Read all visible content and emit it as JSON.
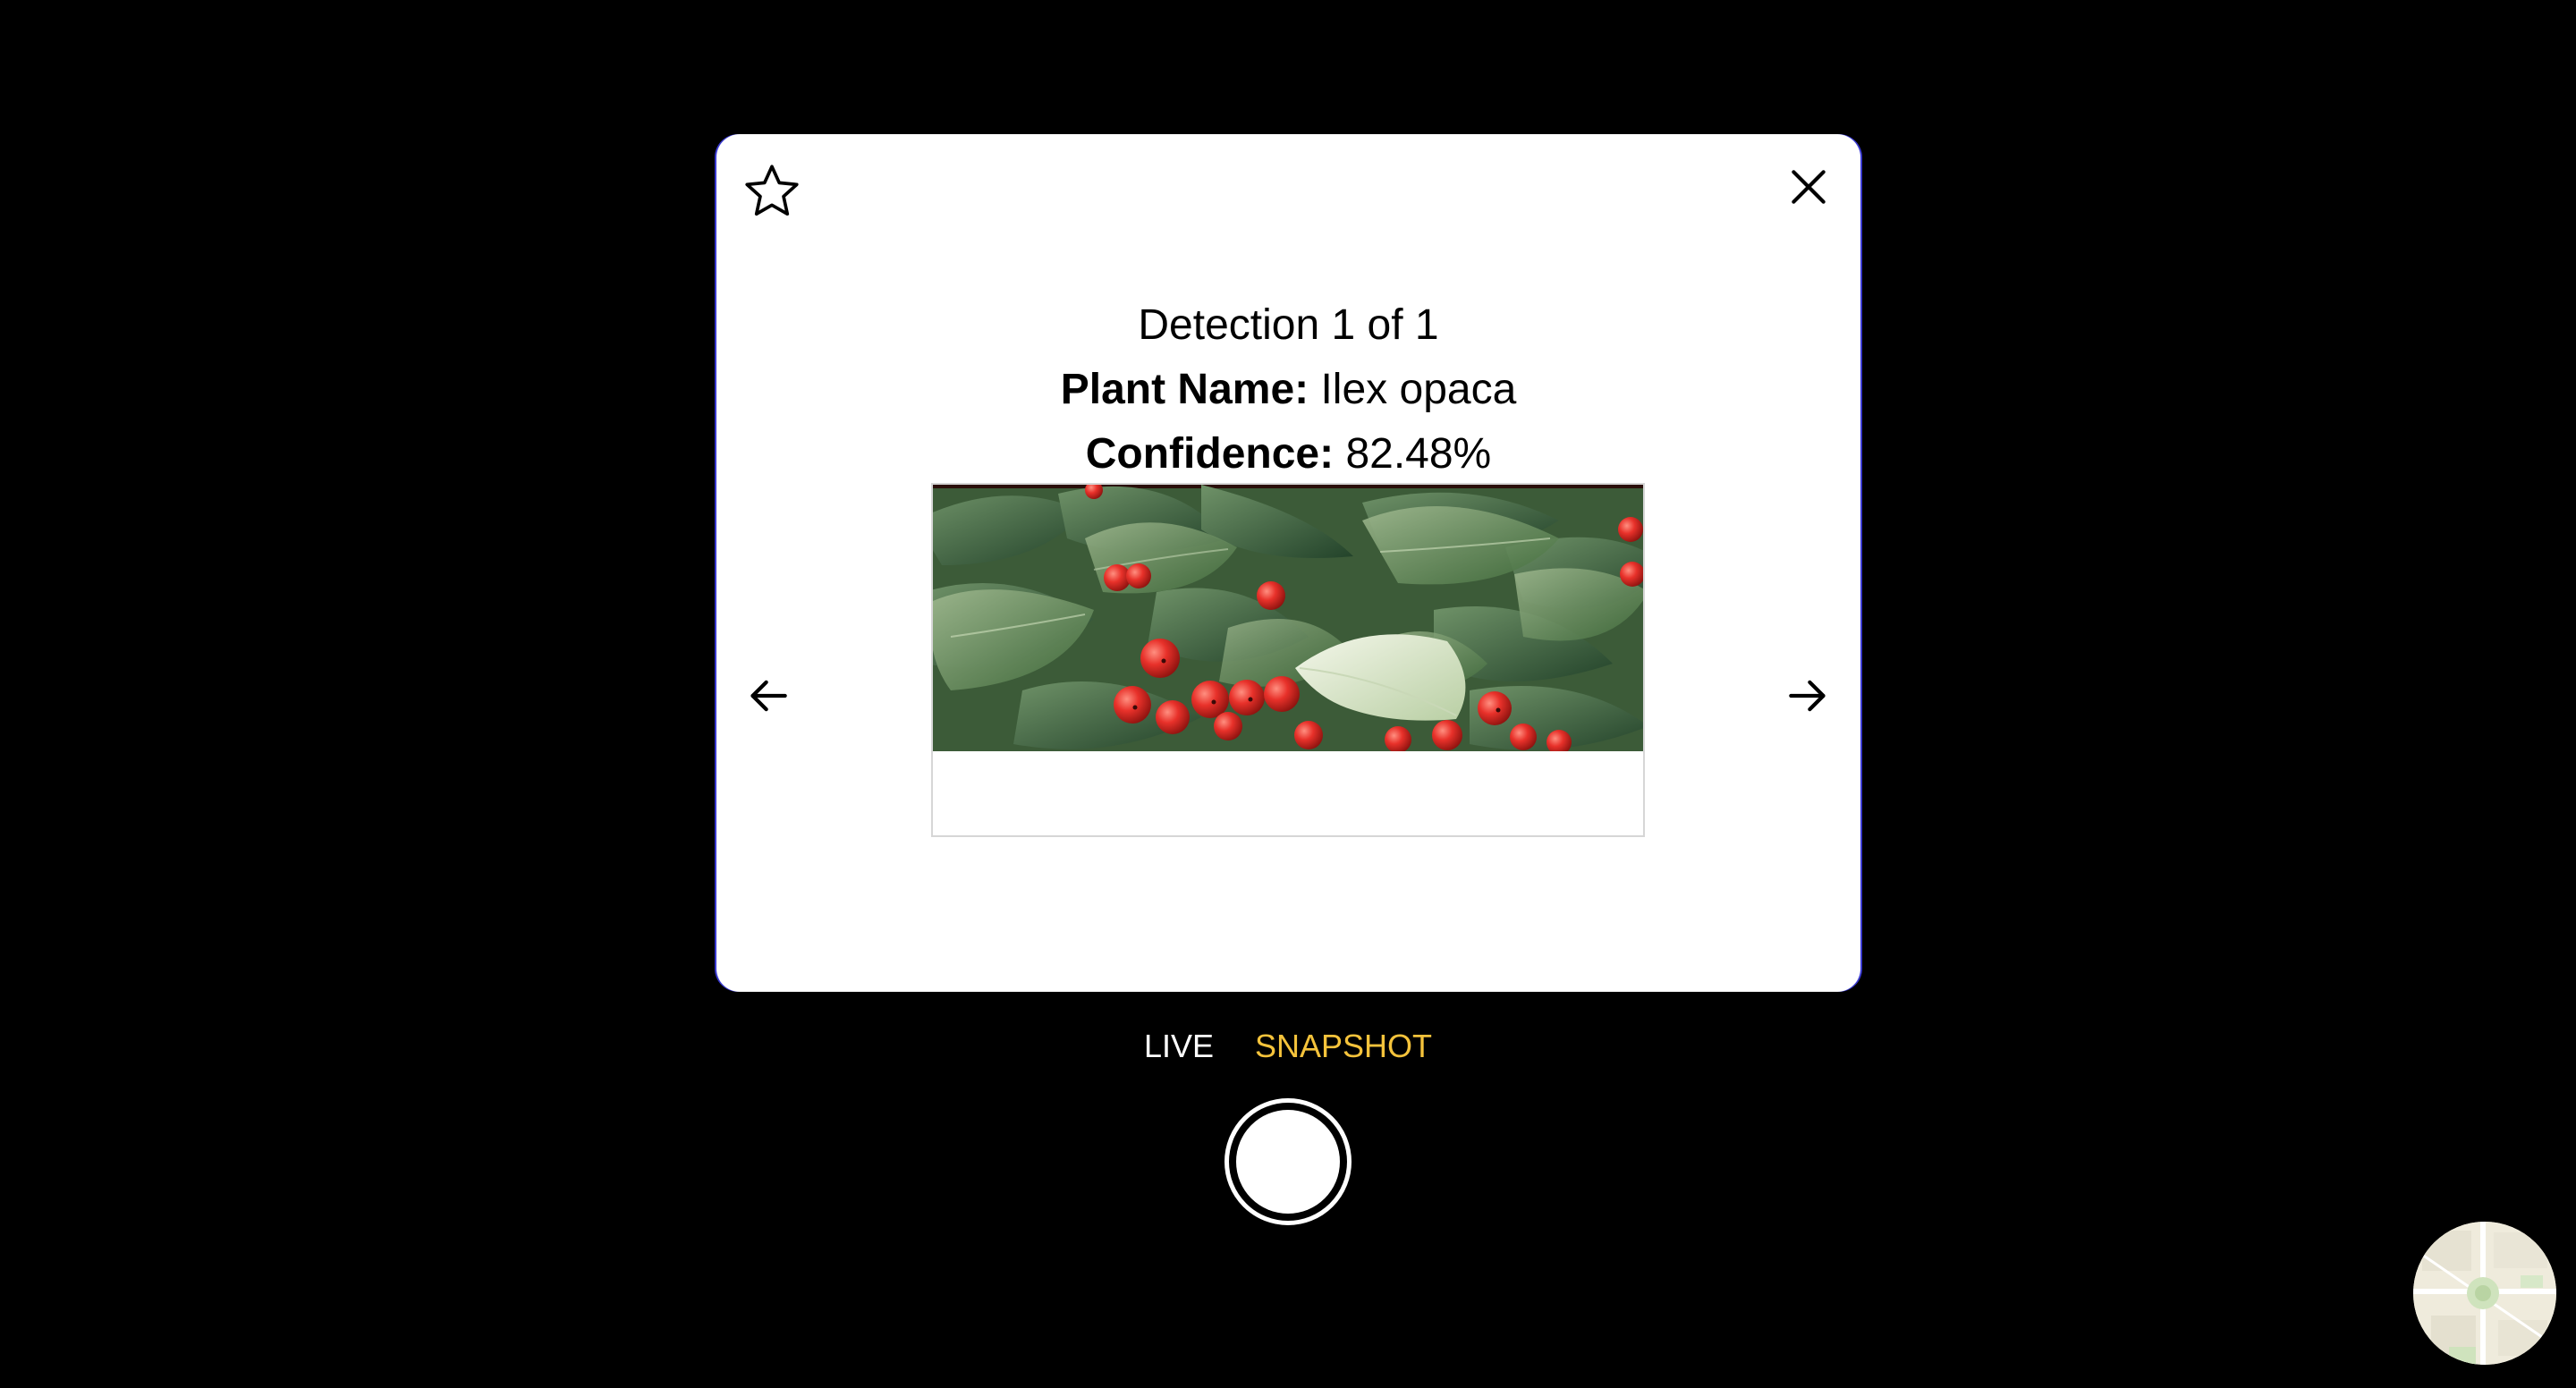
{
  "modal": {
    "detection_text": "Detection 1 of 1",
    "plant_name_label": "Plant Name:",
    "plant_name_value": "Ilex opaca",
    "confidence_label": "Confidence:",
    "confidence_value": "82.48%"
  },
  "icons": {
    "favorite": "star-outline-icon",
    "close": "close-icon",
    "previous": "arrow-left-icon",
    "next": "arrow-right-icon"
  },
  "camera": {
    "modes": [
      {
        "label": "LIVE",
        "active": false
      },
      {
        "label": "SNAPSHOT",
        "active": true
      }
    ]
  },
  "colors": {
    "background": "#000000",
    "modal_background": "#ffffff",
    "active_mode": "#f5c33b",
    "inactive_mode": "#ffffff",
    "modal_edge": "#3a3ad0"
  }
}
